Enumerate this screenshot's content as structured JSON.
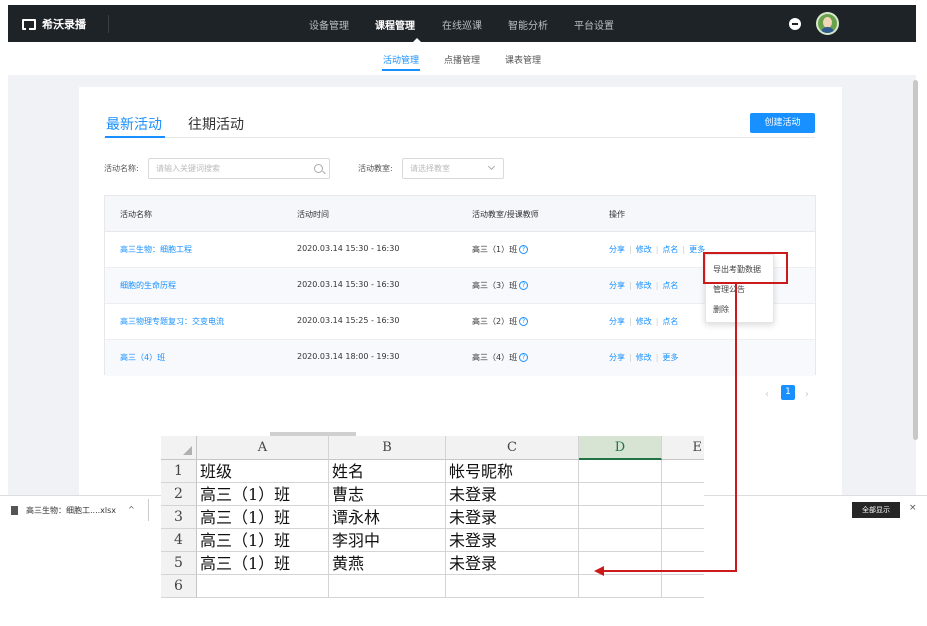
{
  "header": {
    "logo_text": "希沃录播",
    "nav": [
      "设备管理",
      "课程管理",
      "在线巡课",
      "智能分析",
      "平台设置"
    ],
    "active_nav": "课程管理"
  },
  "subnav": {
    "items": [
      "活动管理",
      "点播管理",
      "课表管理"
    ],
    "active": "活动管理"
  },
  "tabs": {
    "latest": "最新活动",
    "past": "往期活动"
  },
  "create_button": "创建活动",
  "filters": {
    "name_label": "活动名称:",
    "name_placeholder": "请输入关键词搜索",
    "room_label": "活动教室:",
    "room_placeholder": "请选择教室"
  },
  "table": {
    "headers": [
      "活动名称",
      "活动时间",
      "活动教室/授课教师",
      "操作"
    ],
    "rows": [
      {
        "name": "高三生物：细胞工程",
        "time": "2020.03.14 15:30 - 16:30",
        "room": "高三（1）班",
        "ops": [
          "分享",
          "修改",
          "点名",
          "更多"
        ]
      },
      {
        "name": "细胞的生命历程",
        "time": "2020.03.14 15:30 - 16:30",
        "room": "高三（3）班",
        "ops": [
          "分享",
          "修改",
          "点名"
        ]
      },
      {
        "name": "高三物理专题复习：交变电流",
        "time": "2020.03.14 15:25 - 16:30",
        "room": "高三（2）班",
        "ops": [
          "分享",
          "修改",
          "点名"
        ]
      },
      {
        "name": "高三（4）班",
        "time": "2020.03.14 18:00 - 19:30",
        "room": "高三（4）班",
        "ops": [
          "分享",
          "修改",
          "更多"
        ]
      }
    ]
  },
  "more_menu": [
    "导出考勤数据",
    "管理公告",
    "删除"
  ],
  "pagination": {
    "prev": "‹",
    "current": "1",
    "next": "›"
  },
  "download_bar": {
    "file": "高三生物：细胞工....xlsx",
    "caret": "^",
    "show_all": "全部显示",
    "close": "×"
  },
  "spreadsheet": {
    "columns": [
      "A",
      "B",
      "C",
      "D",
      "E"
    ],
    "row_numbers": [
      "1",
      "2",
      "3",
      "4",
      "5",
      "6"
    ],
    "rows": [
      [
        "班级",
        "姓名",
        "帐号昵称"
      ],
      [
        "高三（1）班",
        "曹志",
        "未登录"
      ],
      [
        "高三（1）班",
        "谭永林",
        "未登录"
      ],
      [
        "高三（1）班",
        "李羽中",
        "未登录"
      ],
      [
        "高三（1）班",
        "黄燕",
        "未登录"
      ],
      [
        "",
        "",
        ""
      ]
    ]
  },
  "colors": {
    "accent": "#1890ff",
    "nav_bg": "#1e2327",
    "annotation": "#cc1a1a"
  }
}
